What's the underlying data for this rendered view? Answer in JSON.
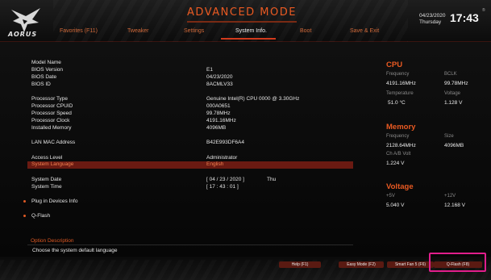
{
  "header": {
    "logo_text": "AORUS",
    "mode_title": "ADVANCED MODE",
    "tabs": [
      {
        "label": "Favorites (F11)"
      },
      {
        "label": "Tweaker"
      },
      {
        "label": "Settings"
      },
      {
        "label": "System Info."
      },
      {
        "label": "Boot"
      },
      {
        "label": "Save & Exit"
      }
    ],
    "date": "04/23/2020",
    "day": "Thursday",
    "time": "17:43",
    "reg_mark": "®"
  },
  "info": {
    "rows": [
      {
        "label": "Model Name",
        "value": ""
      },
      {
        "label": "BIOS Version",
        "value": "E1"
      },
      {
        "label": "BIOS Date",
        "value": "04/23/2020"
      },
      {
        "label": "BIOS ID",
        "value": "8ACMLV33"
      },
      {
        "label": "Processor Type",
        "value": "Genuine Intel(R) CPU 0000 @ 3.30GHz"
      },
      {
        "label": "Processor CPUID",
        "value": "000A0651"
      },
      {
        "label": "Processor Speed",
        "value": "99.78MHz"
      },
      {
        "label": "Processor Clock",
        "value": "4191.16MHz"
      },
      {
        "label": "Installed Memory",
        "value": "4096MB"
      },
      {
        "label": "LAN MAC Address",
        "value": "B42E993DF6A4"
      },
      {
        "label": "Access Level",
        "value": "Administrator"
      },
      {
        "label": "System Language",
        "value": "English"
      }
    ],
    "system_date": {
      "label": "System Date",
      "value": "[  04  /  23  /  2020  ]",
      "day": "Thu"
    },
    "system_time": {
      "label": "System Time",
      "value": "[  17  :  43  :  01  ]"
    },
    "plug_in_devices": "Plug in Devices Info",
    "qflash": "Q-Flash",
    "option_description_title": "Option Description",
    "option_description_text": "Choose the system default language"
  },
  "right_panel": {
    "cpu": {
      "title": "CPU",
      "frequency_label": "Frequency",
      "frequency_value": "4191.16MHz",
      "bclk_label": "BCLK",
      "bclk_value": "99.78MHz",
      "temperature_label": "Temperature",
      "temperature_value": "51.0 °C",
      "voltage_label": "Voltage",
      "voltage_value": "1.128 V"
    },
    "memory": {
      "title": "Memory",
      "frequency_label": "Frequency",
      "frequency_value": "2128.64MHz",
      "size_label": "Size",
      "size_value": "4096MB",
      "chab_label": "Ch A/B Volt",
      "chab_value": "1.224 V"
    },
    "voltage": {
      "title": "Voltage",
      "p5_label": "+5V",
      "p5_value": "5.040 V",
      "p12_label": "+12V",
      "p12_value": "12.168 V"
    }
  },
  "bottom_buttons": [
    {
      "label": "Help (F1)"
    },
    {
      "label": "Easy Mode (F2)"
    },
    {
      "label": "Smart Fan 5 (F6)"
    },
    {
      "label": "Q-Flash (F8)"
    }
  ],
  "colors": {
    "accent": "#ea5a22",
    "selected_row": "#6a1a12",
    "highlight_box": "#e11e8c"
  }
}
